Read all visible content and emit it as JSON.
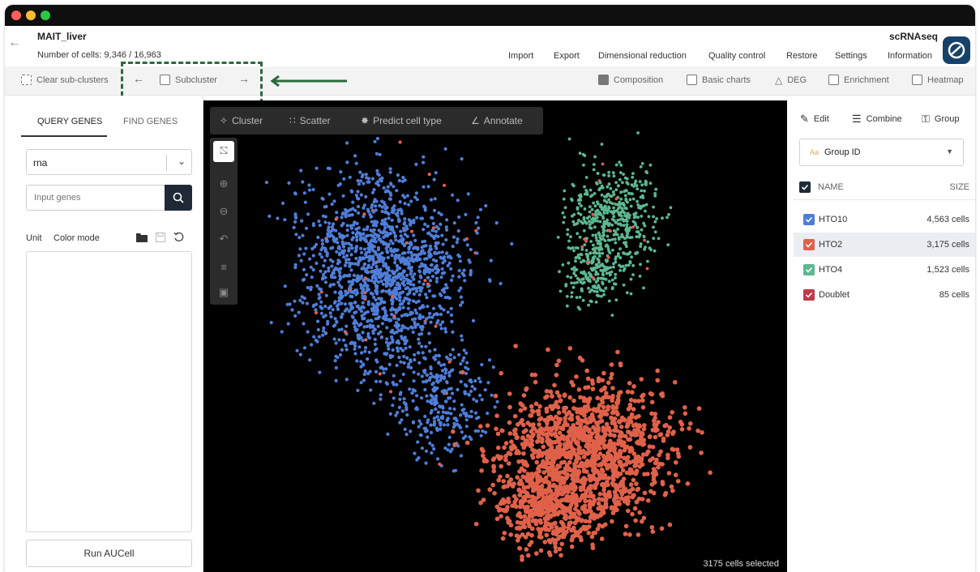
{
  "header": {
    "title": "MAIT_liver",
    "cell_count": "Number of cells: 9,346 / 16,963",
    "menu": [
      "Import",
      "Export",
      "Dimensional reduction",
      "Quality control",
      "Restore",
      "Settings",
      "Information"
    ],
    "brand": "scRNAseq"
  },
  "toolbar": {
    "clear": "Clear sub-clusters",
    "subcluster": "Subcluster",
    "composition": "Composition",
    "basic_charts": "Basic charts",
    "deg": "DEG",
    "enrichment": "Enrichment",
    "heatmap": "Heatmap"
  },
  "left": {
    "tabs": [
      "QUERY GENES",
      "FIND GENES"
    ],
    "select_value": "rna",
    "input_placeholder": "Input genes",
    "unit": "Unit",
    "color_mode": "Color mode",
    "run_button": "Run AUCell"
  },
  "plot": {
    "tools": [
      "Cluster",
      "Scatter",
      "Predict cell type",
      "Annotate"
    ],
    "selected_text": "3175 cells selected"
  },
  "right": {
    "actions": [
      "Edit",
      "Combine",
      "Group"
    ],
    "group_select": "Group ID",
    "col_name": "NAME",
    "col_size": "SIZE",
    "groups": [
      {
        "name": "HTO10",
        "size": "4,563 cells",
        "color": "#4f7ed9"
      },
      {
        "name": "HTO2",
        "size": "3,175 cells",
        "color": "#e0614a"
      },
      {
        "name": "HTO4",
        "size": "1,523 cells",
        "color": "#5cb891"
      },
      {
        "name": "Doublet",
        "size": "85 cells",
        "color": "#c0394b"
      }
    ]
  },
  "colors": {
    "accent": "#1f2a36",
    "highlight": "#2a6a3b",
    "titlebar": "#0f0f0f"
  }
}
